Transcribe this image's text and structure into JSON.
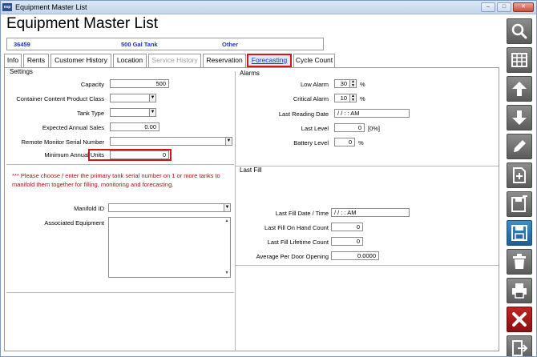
{
  "window": {
    "title": "Equipment Master List",
    "app_icon_text": "esp"
  },
  "page_title": "Equipment Master List",
  "header": {
    "number": "36459",
    "tank": "500 Gal Tank",
    "category": "Other"
  },
  "tabs": [
    "Info",
    "Rents",
    "Customer History",
    "Location",
    "Service History",
    "Reservation",
    "Forecasting",
    "Cycle Count"
  ],
  "settings": {
    "title": "Settings",
    "capacity_label": "Capacity",
    "capacity_value": "500",
    "container_label": "Container Content Product Class",
    "container_value": "",
    "tank_type_label": "Tank Type",
    "tank_type_value": "",
    "expected_label": "Expected Annual Sales",
    "expected_value": "0.00",
    "remote_label": "Remote Monitor Serial Number",
    "remote_value": "",
    "min_units_label": "Minimum Annual Units",
    "min_units_value": "0",
    "warning": "*** Please choose / enter the primary tank serial number on 1 or more tanks to manifold them together for filling, monitoring and forecasting.",
    "manifold_label": "Manifold ID",
    "manifold_value": "",
    "associated_label": "Associated Equipment"
  },
  "alarms": {
    "title": "Alarms",
    "low_label": "Low Alarm",
    "low_value": "30",
    "low_unit": "%",
    "critical_label": "Critical Alarm",
    "critical_value": "10",
    "critical_unit": "%",
    "reading_label": "Last Reading Date",
    "reading_value": "/  /      :  :  AM",
    "level_label": "Last Level",
    "level_value": "0",
    "level_unit": "[0%]",
    "battery_label": "Battery Level",
    "battery_value": "0",
    "battery_unit": "%"
  },
  "last_fill": {
    "title": "Last Fill",
    "date_label": "Last Fill Date / Time",
    "date_value": "/  /      :  :  AM",
    "onhand_label": "Last Fill On Hand Count",
    "onhand_value": "0",
    "lifetime_label": "Last Fill Lifetime Count",
    "lifetime_value": "0",
    "avg_label": "Average Per Door Opening",
    "avg_value": "0.0000"
  },
  "sidebar_icons": [
    "search-icon",
    "grid-icon",
    "arrow-up-icon",
    "arrow-down-icon",
    "pencil-icon",
    "new-document-icon",
    "save-as-icon",
    "save-icon",
    "trash-icon",
    "print-icon",
    "close-icon",
    "exit-icon"
  ],
  "colors": {
    "accent_blue": "#1a34c8",
    "highlight_red": "#d01818",
    "warning_text": "#b01010"
  }
}
